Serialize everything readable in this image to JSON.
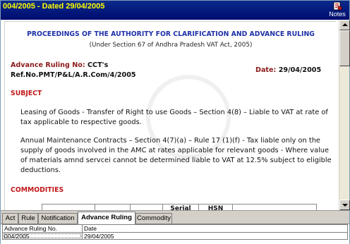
{
  "window": {
    "title": "004/2005 - Dated 29/04/2005",
    "notes_label": "Notes"
  },
  "document": {
    "heading": "PROCEEDINGS OF THE AUTHORITY FOR CLARIFICATION AND ADVANCE RULING",
    "subheading": "(Under Section 67 of Andhra Pradesh VAT Act, 2005)",
    "advance_ruling_label": "Advance Ruling No:",
    "advance_ruling_value": "CCT's",
    "reference": "Ref.No.PMT/P&L/A.R.Com/4/2005",
    "date_label": "Date:",
    "date_value": "29/04/2005",
    "subject_heading": "SUBJECT",
    "subject_para_1": "Leasing of Goods - Transfer of Right to use Goods – Section 4(8) – Liable to VAT at rate of tax applicable to respective goods.",
    "subject_para_2": "Annual Maintenance Contracts – Section 4(7)(a) – Rule 17 (1)(f) - Tax liable only on the supply of goods involved in the AMC at rates applicable for relevant goods - Where value of materials amnd servcei cannot be determined liable to VAT at 12.5% subject to eligible deductions.",
    "commodities_heading": "COMMODITIES",
    "table_headers": [
      "",
      "",
      "",
      "Serial",
      "HSN",
      ""
    ]
  },
  "tabs": [
    {
      "label": "Act",
      "active": false
    },
    {
      "label": "Rule",
      "active": false
    },
    {
      "label": "Notification",
      "active": false
    },
    {
      "label": "Advance Ruling",
      "active": true
    },
    {
      "label": "Commodity",
      "active": false
    }
  ],
  "grid": {
    "columns": [
      "Advance Ruling No.",
      "Date"
    ],
    "rows": [
      [
        "004/2005",
        "29/04/2005"
      ]
    ]
  },
  "colors": {
    "title_bar": "#0a2a8c",
    "title_text": "#ffff00",
    "heading_blue": "#1f32a8",
    "section_red": "#c0181a",
    "label_maroon": "#8b1a1a"
  }
}
